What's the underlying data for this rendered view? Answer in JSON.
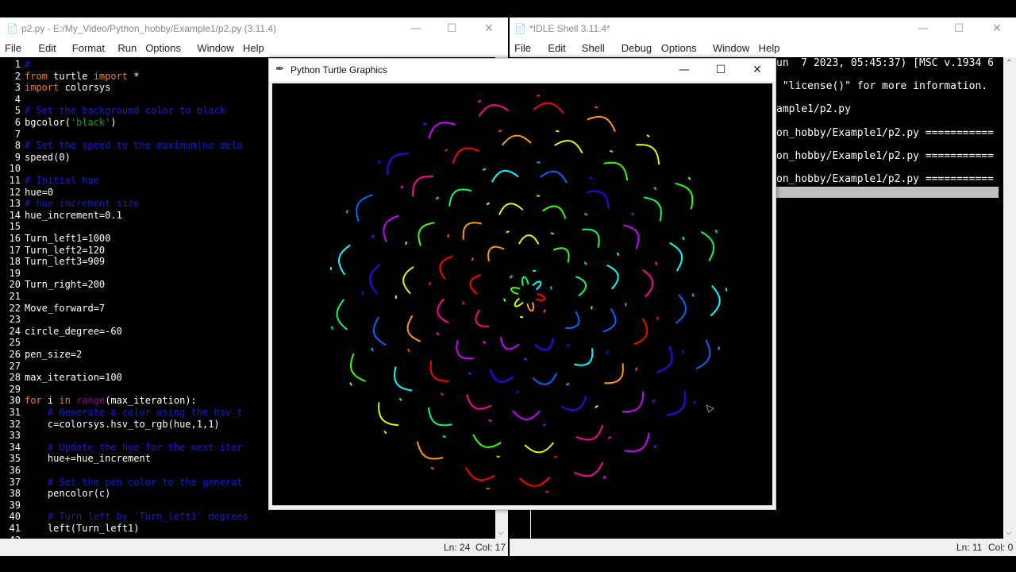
{
  "editor": {
    "title": "p2.py - E:/My_Video/Python_hobby/Example1/p2.py (3.11.4)",
    "menus": [
      "File",
      "Edit",
      "Format",
      "Run",
      "Options",
      "Window",
      "Help"
    ],
    "status": {
      "ln": "Ln: 24",
      "col": "Col: 17"
    },
    "lines": [
      {
        "n": "1",
        "parts": [
          {
            "t": "#",
            "c": "cmt"
          }
        ]
      },
      {
        "n": "2",
        "parts": [
          {
            "t": "from",
            "c": "kw"
          },
          {
            "t": " turtle ",
            "c": ""
          },
          {
            "t": "import",
            "c": "kw"
          },
          {
            "t": " *",
            "c": ""
          }
        ]
      },
      {
        "n": "3",
        "parts": [
          {
            "t": "import",
            "c": "kw"
          },
          {
            "t": " colorsys",
            "c": ""
          }
        ]
      },
      {
        "n": "4",
        "parts": []
      },
      {
        "n": "5",
        "parts": [
          {
            "t": "# Set the background color to black",
            "c": "cmt"
          }
        ]
      },
      {
        "n": "6",
        "parts": [
          {
            "t": "bgcolor(",
            "c": ""
          },
          {
            "t": "'black'",
            "c": "str"
          },
          {
            "t": ")",
            "c": ""
          }
        ]
      },
      {
        "n": "7",
        "parts": []
      },
      {
        "n": "8",
        "parts": [
          {
            "t": "# Set the speed to the maximum(no dela",
            "c": "cmt"
          }
        ]
      },
      {
        "n": "9",
        "parts": [
          {
            "t": "speed(0)",
            "c": ""
          }
        ]
      },
      {
        "n": "10",
        "parts": []
      },
      {
        "n": "11",
        "parts": [
          {
            "t": "# Initial hue",
            "c": "cmt"
          }
        ]
      },
      {
        "n": "12",
        "parts": [
          {
            "t": "hue=0",
            "c": ""
          }
        ]
      },
      {
        "n": "13",
        "parts": [
          {
            "t": "# hue increment size",
            "c": "cmt"
          }
        ]
      },
      {
        "n": "14",
        "parts": [
          {
            "t": "hue_increment=0.1",
            "c": ""
          }
        ]
      },
      {
        "n": "15",
        "parts": []
      },
      {
        "n": "16",
        "parts": [
          {
            "t": "Turn_left1=1000",
            "c": ""
          }
        ]
      },
      {
        "n": "17",
        "parts": [
          {
            "t": "Turn_left2=120",
            "c": ""
          }
        ]
      },
      {
        "n": "18",
        "parts": [
          {
            "t": "Turn_left3=909",
            "c": ""
          }
        ]
      },
      {
        "n": "19",
        "parts": []
      },
      {
        "n": "20",
        "parts": [
          {
            "t": "Turn_right=200",
            "c": ""
          }
        ]
      },
      {
        "n": "21",
        "parts": []
      },
      {
        "n": "22",
        "parts": [
          {
            "t": "Move_forward=7",
            "c": ""
          }
        ]
      },
      {
        "n": "23",
        "parts": []
      },
      {
        "n": "24",
        "parts": [
          {
            "t": "circle_degree=-60",
            "c": ""
          }
        ]
      },
      {
        "n": "25",
        "parts": []
      },
      {
        "n": "26",
        "parts": [
          {
            "t": "pen_size=2",
            "c": ""
          }
        ]
      },
      {
        "n": "27",
        "parts": []
      },
      {
        "n": "28",
        "parts": [
          {
            "t": "max_iteration=100",
            "c": ""
          }
        ]
      },
      {
        "n": "29",
        "parts": []
      },
      {
        "n": "30",
        "parts": [
          {
            "t": "for",
            "c": "kw"
          },
          {
            "t": " i ",
            "c": ""
          },
          {
            "t": "in",
            "c": "kw"
          },
          {
            "t": " ",
            "c": ""
          },
          {
            "t": "range",
            "c": "bi"
          },
          {
            "t": "(max_iteration):",
            "c": ""
          }
        ]
      },
      {
        "n": "31",
        "parts": [
          {
            "t": "    # Generate a color using the hsv_t",
            "c": "cmt"
          }
        ]
      },
      {
        "n": "32",
        "parts": [
          {
            "t": "    c=colorsys.hsv_to_rgb(hue,1,1)",
            "c": ""
          }
        ]
      },
      {
        "n": "33",
        "parts": []
      },
      {
        "n": "34",
        "parts": [
          {
            "t": "    # Update the hue for the next iter",
            "c": "cmt"
          }
        ]
      },
      {
        "n": "35",
        "parts": [
          {
            "t": "    hue+=hue_increment",
            "c": ""
          }
        ]
      },
      {
        "n": "36",
        "parts": []
      },
      {
        "n": "37",
        "parts": [
          {
            "t": "    # Set the pen color to the generat",
            "c": "cmt"
          }
        ]
      },
      {
        "n": "38",
        "parts": [
          {
            "t": "    pencolor(c)",
            "c": ""
          }
        ]
      },
      {
        "n": "39",
        "parts": []
      },
      {
        "n": "40",
        "parts": [
          {
            "t": "    # Turn left by 'Turn_left1' degrees",
            "c": "cmt"
          }
        ]
      },
      {
        "n": "41",
        "parts": [
          {
            "t": "    left(Turn_left1)",
            "c": ""
          }
        ]
      },
      {
        "n": "42",
        "parts": []
      }
    ]
  },
  "shell": {
    "title": "*IDLE Shell 3.11.4*",
    "menus": [
      "File",
      "Edit",
      "Shell",
      "Debug",
      "Options",
      "Window",
      "Help"
    ],
    "status": {
      "ln": "Ln: 11",
      "col": "Col: 0"
    },
    "lines": [
      "un  7 2023, 05:45:37) [MSC v.1934 6",
      " \"license()\" for more information.",
      "ample1/p2.py",
      "on_hobby/Example1/p2.py ===========",
      "on_hobby/Example1/p2.py ===========",
      "on_hobby/Example1/p2.py ==========="
    ]
  },
  "turtle": {
    "title": "Python Turtle Graphics",
    "icon": "feather-icon",
    "background": "#000000"
  },
  "window_controls": {
    "minimize": "—",
    "maximize": "☐",
    "close": "✕"
  }
}
